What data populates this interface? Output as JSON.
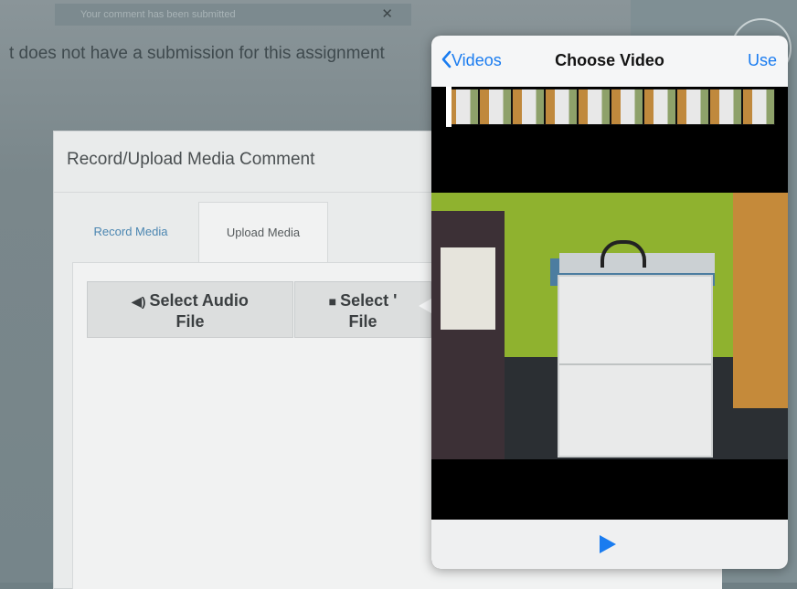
{
  "background": {
    "toast_text": "Your comment has been submitted",
    "toast_close": "✕",
    "message": "t does not have a submission for this assignment"
  },
  "modal": {
    "title": "Record/Upload Media Comment",
    "tabs": [
      {
        "label": "Record Media",
        "active": false
      },
      {
        "label": "Upload Media",
        "active": true
      }
    ],
    "buttons": {
      "audio_icon": "◀)",
      "audio_label_line1": "Select Audio",
      "audio_label_line2": "File",
      "video_icon": "■",
      "video_label_line1": "Select '",
      "video_label_line2": "File"
    }
  },
  "picker": {
    "back_label": "Videos",
    "back_icon": "chevron-left-icon",
    "title": "Choose Video",
    "use_label": "Use",
    "play_icon": "play-icon",
    "accent_color": "#1a7cf0"
  }
}
